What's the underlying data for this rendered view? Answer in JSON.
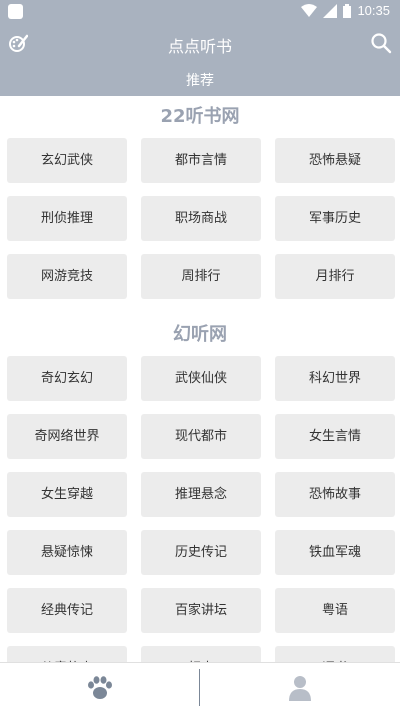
{
  "status_bar": {
    "time": "10:35"
  },
  "app_bar": {
    "title": "点点听书",
    "tab": "推荐"
  },
  "sections": [
    {
      "title": "22听书网",
      "items": [
        "玄幻武侠",
        "都市言情",
        "恐怖悬疑",
        "刑侦推理",
        "职场商战",
        "军事历史",
        "网游竞技",
        "周排行",
        "月排行"
      ]
    },
    {
      "title": "幻听网",
      "items": [
        "奇幻玄幻",
        "武侠仙侠",
        "科幻世界",
        "奇网络世界",
        "现代都市",
        "女生言情",
        "女生穿越",
        "推理悬念",
        "恐怖故事",
        "悬疑惊悚",
        "历史传记",
        "铁血军魂",
        "经典传记",
        "百家讲坛",
        "粤语",
        "儿童故事",
        "相声",
        "评书"
      ]
    }
  ],
  "bottom_nav": {
    "left_icon": "paw-icon",
    "right_icon": "user-icon"
  },
  "colors": {
    "accent": "#a9b2bf",
    "section_title": "#9aa2b1",
    "cell_bg": "#ececec"
  }
}
